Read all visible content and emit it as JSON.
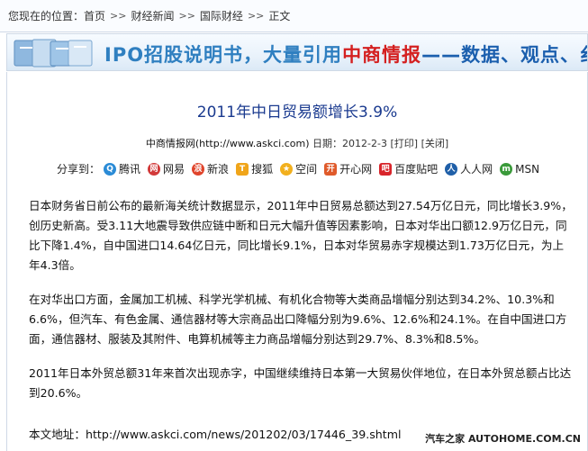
{
  "breadcrumb": {
    "prefix": "您现在的位置：",
    "items": [
      "首页",
      "财经新闻",
      "国际财经",
      "正文"
    ],
    "separator": ">>"
  },
  "banner": {
    "text_part1": "IPO招股说明书，大量引用",
    "text_part2": "中商情报",
    "text_part3": "——数据、观点、纟"
  },
  "article": {
    "title": "2011年中日贸易额增长3.9%",
    "meta": {
      "source": "中商情报网(http://www.askci.com)",
      "date_label": "日期：",
      "date": "2012-2-3",
      "print": "[打印]",
      "close": "[关闭]"
    },
    "share": {
      "label": "分享到：",
      "items": [
        {
          "name": "腾讯",
          "icon": "tencent-icon",
          "color": "#2a8bd6"
        },
        {
          "name": "网易",
          "icon": "netease-icon",
          "color": "#d23a3a"
        },
        {
          "name": "新浪",
          "icon": "sina-icon",
          "color": "#e0442b"
        },
        {
          "name": "搜狐",
          "icon": "sohu-icon",
          "color": "#f0a51a"
        },
        {
          "name": "空间",
          "icon": "qzone-icon",
          "color": "#f2b01e"
        },
        {
          "name": "开心网",
          "icon": "kaixin-icon",
          "color": "#e05a2a"
        },
        {
          "name": "百度贴吧",
          "icon": "baidu-tieba-icon",
          "color": "#d8242a"
        },
        {
          "name": "人人网",
          "icon": "renren-icon",
          "color": "#1f5fa8"
        },
        {
          "name": "MSN",
          "icon": "msn-icon",
          "color": "#3a9a3a"
        }
      ]
    },
    "paragraphs": [
      "日本财务省日前公布的最新海关统计数据显示，2011年中日贸易总额达到27.54万亿日元，同比增长3.9%，创历史新高。受3.11大地震导致供应链中断和日元大幅升值等因素影响，日本对华出口额12.9万亿日元，同比下降1.4%，自中国进口14.64亿日元，同比增长9.1%，日本对华贸易赤字规模达到1.73万亿日元，为上年4.3倍。",
      "在对华出口方面，金属加工机械、科学光学机械、有机化合物等大类商品增幅分别达到34.2%、10.3%和6.6%，但汽车、有色金属、通信器材等大宗商品出口降幅分别为9.6%、12.6%和24.1%。在自中国进口方面，通信器材、服装及其附件、电算机械等主力商品增幅分别达到29.7%、8.3%和8.5%。",
      "2011年日本外贸总额31年来首次出现赤字，中国继续维持日本第一大贸易伙伴地位，在日本外贸总额占比达到20.6%。"
    ],
    "source_label": "本文地址：",
    "source_url": "http://www.askci.com/news/201202/03/17446_39.shtml"
  },
  "watermark": "汽车之家  AUTOHOME.COM.CN"
}
